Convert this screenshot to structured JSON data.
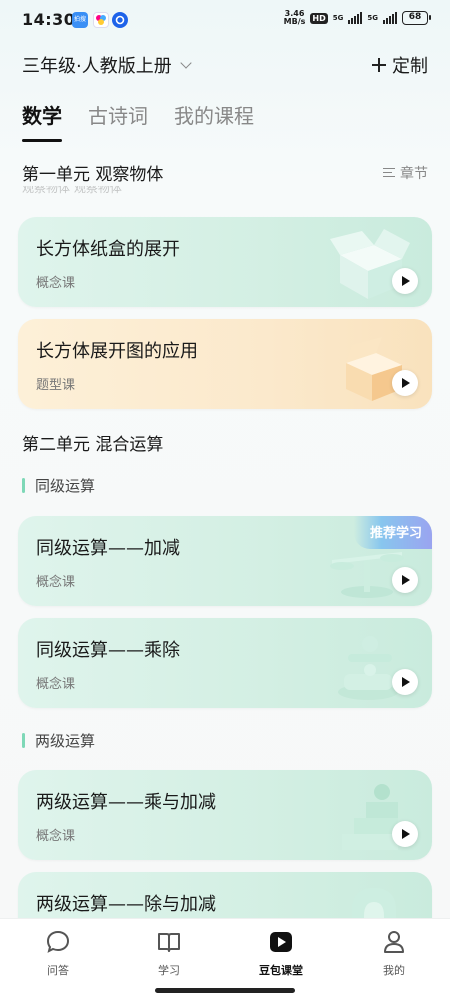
{
  "status_bar": {
    "time": "14:30",
    "app_icon_1": "拍搜",
    "net_speed_value": "3.46",
    "net_speed_unit": "MB/s",
    "hd": "HD",
    "sig1_label": "5G",
    "sig2_label": "5G",
    "battery": "68"
  },
  "header": {
    "grade_label": "三年级·人教版上册",
    "customize_label": "定制"
  },
  "tabs": [
    {
      "label": "数学"
    },
    {
      "label": "古诗词"
    },
    {
      "label": "我的课程"
    }
  ],
  "units": [
    {
      "title": "第一单元 观察物体",
      "chapter_label": "章节"
    },
    {
      "title": "第二单元 混合运算"
    }
  ],
  "ghost_text": "观察物体 观察物体",
  "sections": [
    {
      "label": "同级运算"
    },
    {
      "label": "两级运算"
    }
  ],
  "cards": [
    {
      "title": "长方体纸盒的展开",
      "subtitle": "概念课",
      "theme": "green",
      "icon": "open-box-art"
    },
    {
      "title": "长方体展开图的应用",
      "subtitle": "题型课",
      "theme": "orange",
      "icon": "orange-box-art"
    },
    {
      "title": "同级运算——加减",
      "subtitle": "概念课",
      "theme": "green",
      "icon": "balance-scale-art",
      "badge": "推荐学习"
    },
    {
      "title": "同级运算——乘除",
      "subtitle": "概念课",
      "theme": "green",
      "icon": "divide-sign-art"
    },
    {
      "title": "两级运算——乘与加减",
      "subtitle": "概念课",
      "theme": "green",
      "icon": "stairs-art"
    },
    {
      "title": "两级运算——除与加减",
      "subtitle": "",
      "theme": "green",
      "icon": "arch-art"
    }
  ],
  "bottom_nav": [
    {
      "label": "问答",
      "icon": "chat-bubble-icon"
    },
    {
      "label": "学习",
      "icon": "book-icon"
    },
    {
      "label": "豆包课堂",
      "icon": "play-box-icon",
      "active": true
    },
    {
      "label": "我的",
      "icon": "person-icon"
    }
  ],
  "colors": {
    "card_green": "#d3efe3",
    "card_orange": "#fbe9cc",
    "section_accent": "#7ed8b7",
    "badge_gradient": "#9aa4f0"
  }
}
